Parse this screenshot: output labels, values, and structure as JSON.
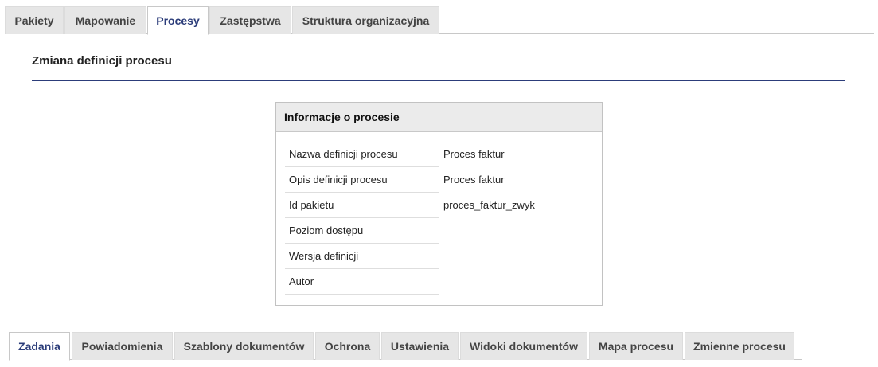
{
  "top_tabs": [
    {
      "label": "Pakiety",
      "active": false
    },
    {
      "label": "Mapowanie",
      "active": false
    },
    {
      "label": "Procesy",
      "active": true
    },
    {
      "label": "Zastępstwa",
      "active": false
    },
    {
      "label": "Struktura organizacyjna",
      "active": false
    }
  ],
  "page_title": "Zmiana definicji procesu",
  "panel": {
    "title": "Informacje o procesie",
    "rows": [
      {
        "label": "Nazwa definicji procesu",
        "value": "Proces faktur"
      },
      {
        "label": "Opis definicji procesu",
        "value": "Proces faktur"
      },
      {
        "label": "Id pakietu",
        "value": "proces_faktur_zwyk"
      },
      {
        "label": "Poziom dostępu",
        "value": ""
      },
      {
        "label": "Wersja definicji",
        "value": ""
      },
      {
        "label": "Autor",
        "value": ""
      }
    ]
  },
  "bottom_tabs": [
    {
      "label": "Zadania",
      "active": true
    },
    {
      "label": "Powiadomienia",
      "active": false
    },
    {
      "label": "Szablony dokumentów",
      "active": false
    },
    {
      "label": "Ochrona",
      "active": false
    },
    {
      "label": "Ustawienia",
      "active": false
    },
    {
      "label": "Widoki dokumentów",
      "active": false
    },
    {
      "label": "Mapa procesu",
      "active": false
    },
    {
      "label": "Zmienne procesu",
      "active": false
    }
  ],
  "colors": {
    "accent": "#2c3d7a",
    "tab_bg": "#e6e6e6"
  }
}
